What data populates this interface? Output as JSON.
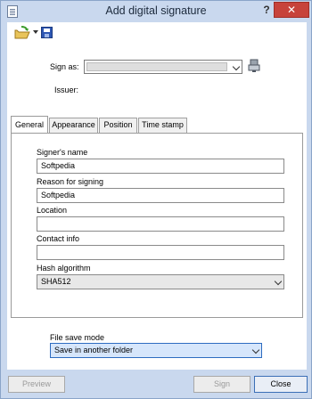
{
  "window": {
    "title": "Add digital signature",
    "help_glyph": "?",
    "close_glyph": "✕"
  },
  "toolbar": {
    "items": [
      "open-icon",
      "dropdown-arrow-icon",
      "save-icon"
    ]
  },
  "signer": {
    "sign_as_label": "Sign as:",
    "sign_as_value": "",
    "issuer_label": "Issuer:",
    "issuer_value": ""
  },
  "tabs": [
    {
      "label": "General",
      "active": true
    },
    {
      "label": "Appearance",
      "active": false
    },
    {
      "label": "Position",
      "active": false
    },
    {
      "label": "Time stamp",
      "active": false
    }
  ],
  "general": {
    "signers_name_label": "Signer's name",
    "signers_name_value": "Softpedia",
    "reason_label": "Reason for signing",
    "reason_value": "Softpedia",
    "location_label": "Location",
    "location_value": "",
    "contact_label": "Contact info",
    "contact_value": "",
    "hash_label": "Hash algorithm",
    "hash_value": "SHA512"
  },
  "file_save": {
    "label": "File save mode",
    "value": "Save in another folder"
  },
  "buttons": {
    "preview": "Preview",
    "sign": "Sign",
    "close": "Close"
  },
  "colors": {
    "frame": "#c9d8ee",
    "close_button": "#c7433b",
    "selected_field": "#d6e6fb"
  }
}
